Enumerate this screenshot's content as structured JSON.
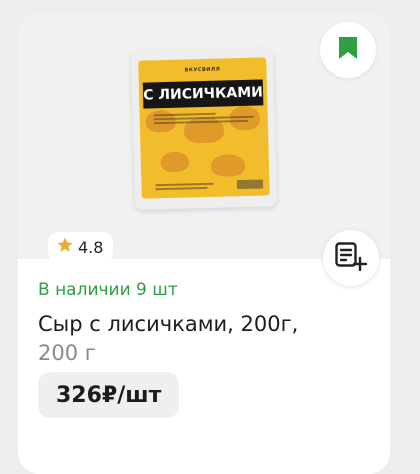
{
  "product": {
    "package_brand": "ВКУСВИЛЛ",
    "package_title": "С ЛИСИЧКАМИ",
    "rating": "4.8",
    "stock": "В наличии 9 шт",
    "title": "Сыр с лисичками, 200г,",
    "weight": "200 г",
    "price": "326₽/шт"
  },
  "icons": {
    "bookmark": "bookmark-icon",
    "star": "star-icon",
    "add_to_list": "add-to-list-icon"
  },
  "colors": {
    "accent_green": "#2f9e44",
    "star": "#f0a830",
    "package_yellow": "#f2bd2c"
  }
}
